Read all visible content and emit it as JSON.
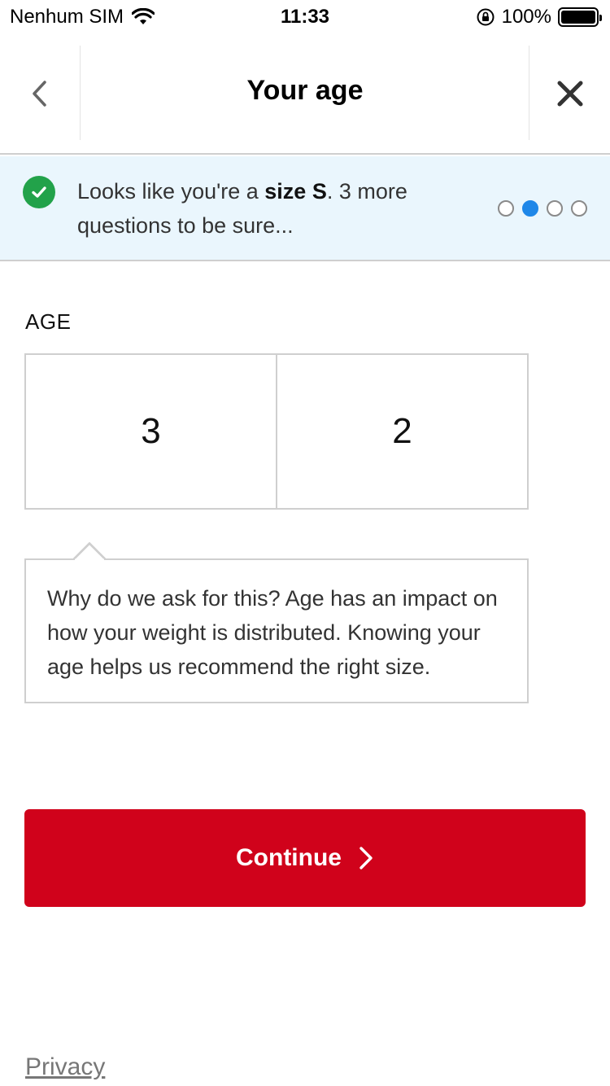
{
  "status_bar": {
    "carrier": "Nenhum SIM",
    "time": "11:33",
    "battery": "100%"
  },
  "header": {
    "title": "Your age",
    "back_icon": "chevron-left-icon",
    "close_icon": "close-icon"
  },
  "banner": {
    "prefix": "Looks like you're a ",
    "size": "size S",
    "suffix": ". 3 more questions to be sure...",
    "progress": {
      "total": 4,
      "current": 2
    },
    "accent": "#1f87e8",
    "check_color": "#22a24a"
  },
  "age": {
    "label": "AGE",
    "digits": [
      "3",
      "2"
    ]
  },
  "tooltip": {
    "text": "Why do we ask for this? Age has an impact on how your weight is distributed. Knowing your age helps us recommend the right size."
  },
  "continue_button": {
    "label": "Continue",
    "color": "#d0021b"
  },
  "footer": {
    "privacy_label": "Privacy"
  }
}
